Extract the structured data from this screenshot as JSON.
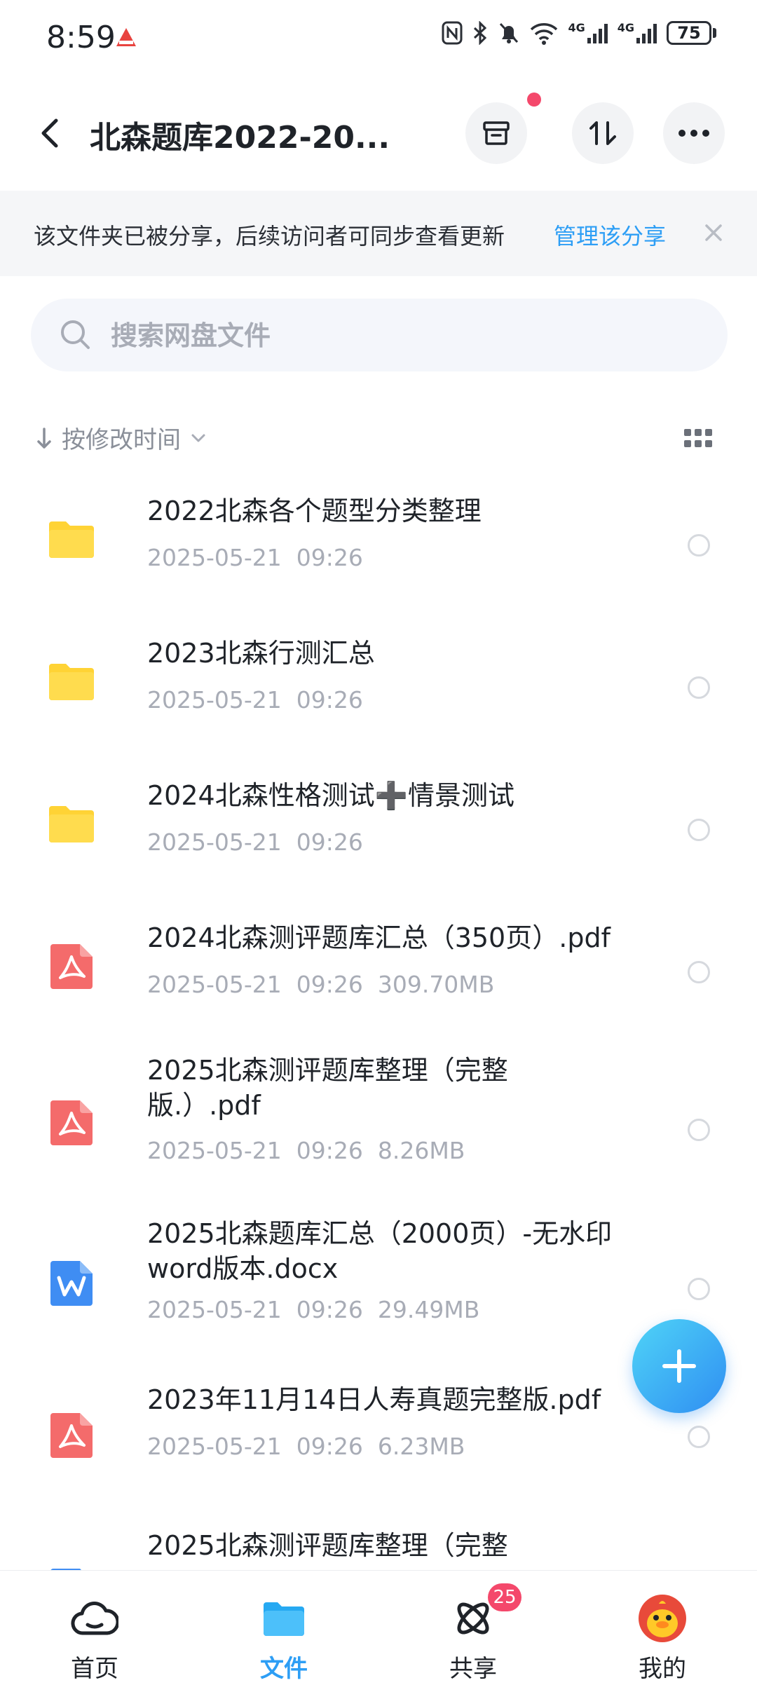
{
  "status_bar": {
    "time": "8:59",
    "battery": "75",
    "network_1": "4G",
    "network_2": "4G"
  },
  "header": {
    "title": "北森题库2022-20...",
    "back_icon": "chevron-left-icon",
    "archive_icon": "archive-box-icon",
    "transfer_icon": "transfer-arrows-icon",
    "more_icon": "more-dots-icon"
  },
  "share_banner": {
    "text": "该文件夹已被分享，后续访问者可同步查看更新",
    "manage_link": "管理该分享"
  },
  "search": {
    "placeholder": "搜索网盘文件"
  },
  "sort": {
    "label": "按修改时间"
  },
  "files": [
    {
      "name": "2022北森各个题型分类整理",
      "meta": "2025-05-21  09:26",
      "type": "folder"
    },
    {
      "name": "2023北森行测汇总",
      "meta": "2025-05-21  09:26",
      "type": "folder"
    },
    {
      "name": "2024北森性格测试➕情景测试",
      "meta": "2025-05-21  09:26",
      "type": "folder"
    },
    {
      "name": "2024北森测评题库汇总（350页）.pdf",
      "meta": "2025-05-21  09:26  309.70MB",
      "type": "pdf"
    },
    {
      "name": "2025北森测评题库整理（完整版.）.pdf",
      "meta": "2025-05-21  09:26  8.26MB",
      "type": "pdf"
    },
    {
      "name": "2025北森题库汇总（2000页）-无水印word版本.docx",
      "meta": "2025-05-21  09:26  29.49MB",
      "type": "word"
    },
    {
      "name": "2023年11月14日人寿真题完整版.pdf",
      "meta": "2025-05-21  09:26  6.23MB",
      "type": "pdf"
    },
    {
      "name": "2025北森测评题库整理（完整",
      "meta": "",
      "type": "word"
    }
  ],
  "bottom_nav": {
    "items": [
      {
        "label": "首页",
        "icon": "cloud-home-icon"
      },
      {
        "label": "文件",
        "icon": "folder-icon",
        "active": true
      },
      {
        "label": "共享",
        "icon": "share-atom-icon",
        "badge": "25"
      },
      {
        "label": "我的",
        "icon": "avatar-duck-icon"
      }
    ]
  },
  "colors": {
    "accent": "#2d9ef5",
    "badge": "#f4486b",
    "folder": "#ffd335",
    "pdf": "#f46b6b",
    "word": "#3f8df3"
  }
}
